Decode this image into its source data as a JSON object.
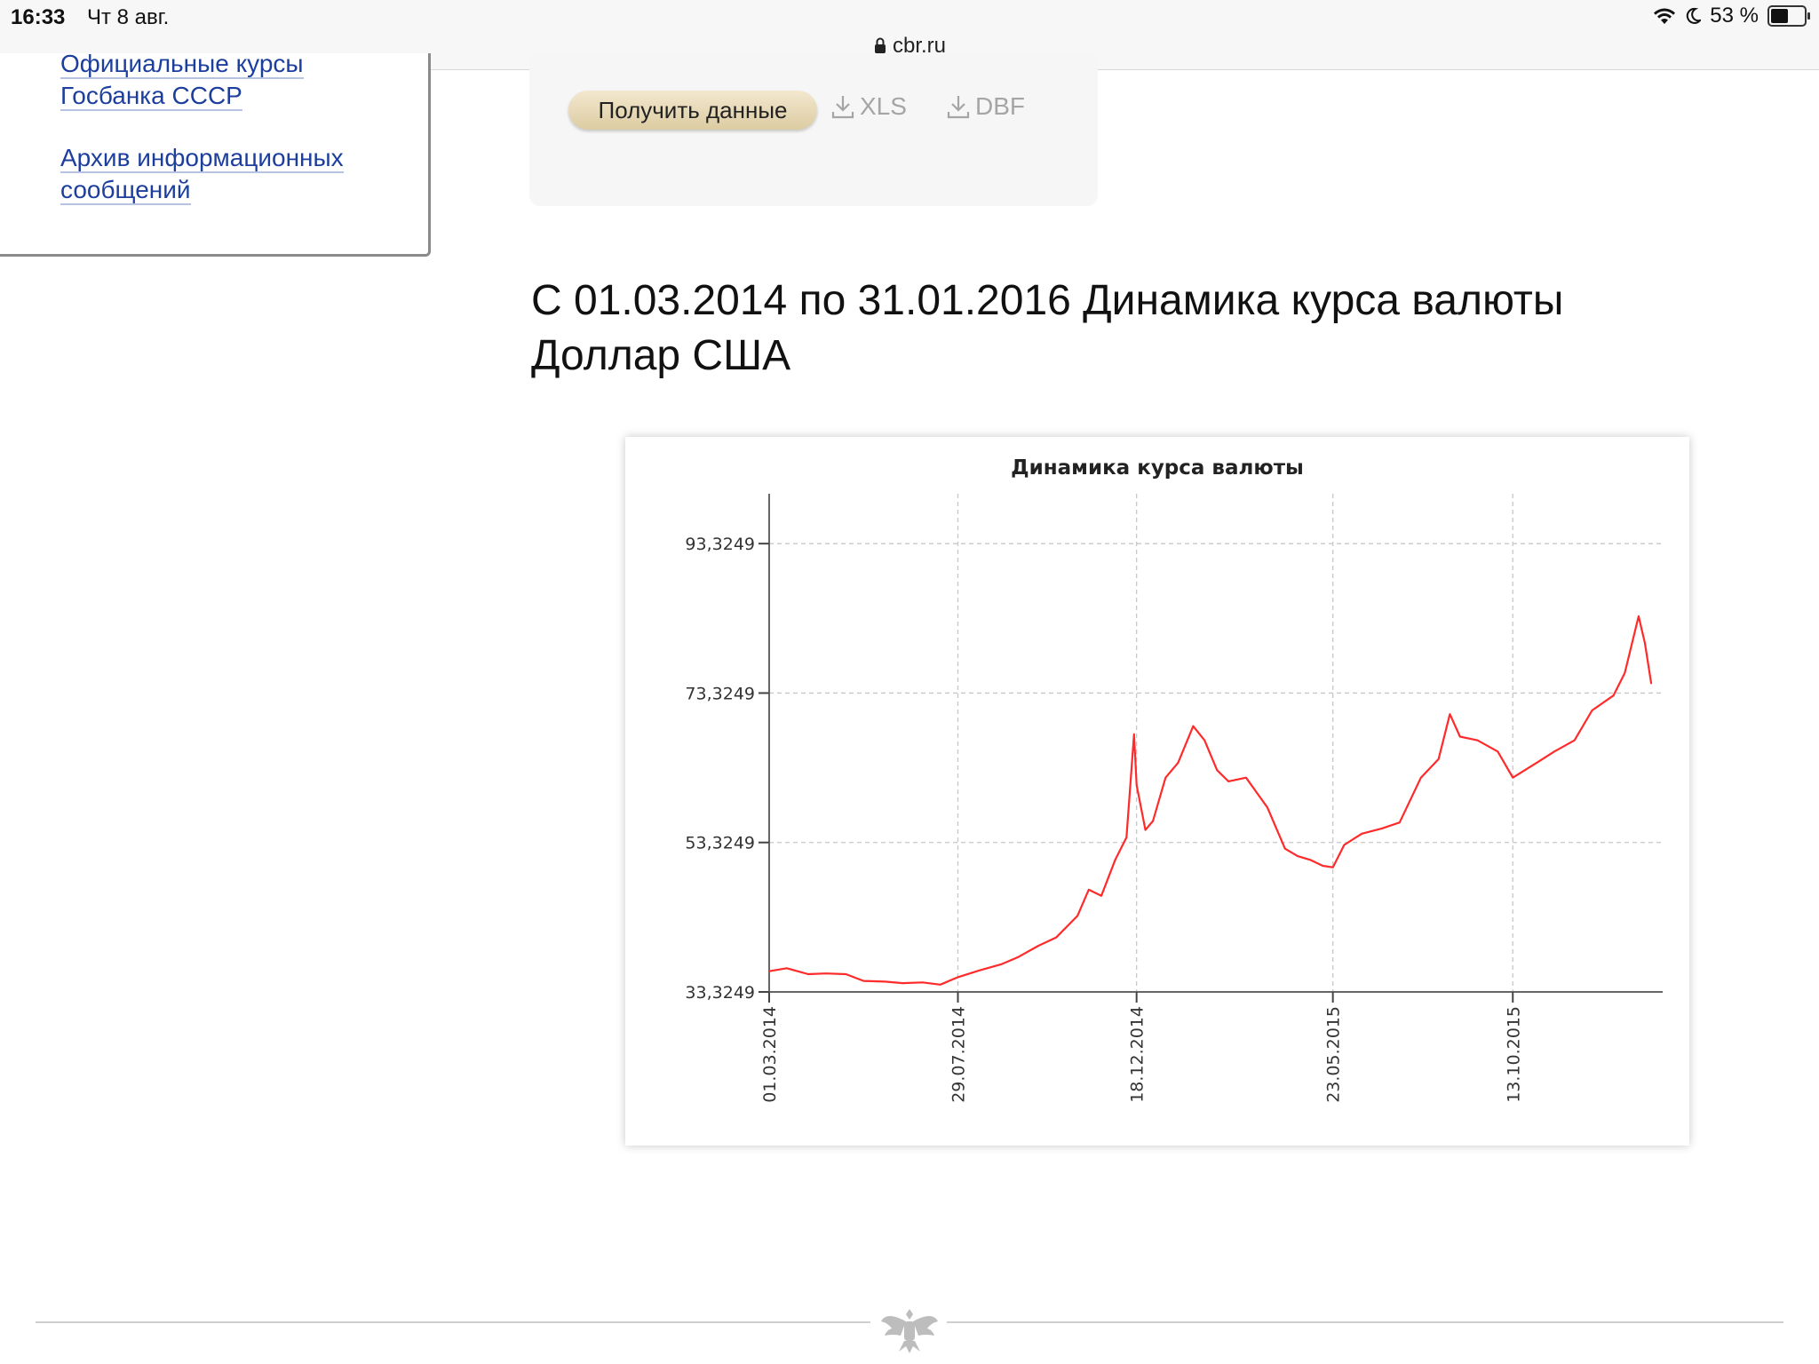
{
  "status_bar": {
    "time": "16:33",
    "date": "Чт 8 авг.",
    "battery": "53 %",
    "battery_level_percent": 53,
    "url": "cbr.ru"
  },
  "sidebar": {
    "links": [
      {
        "lines": [
          "Официальные курсы",
          "Госбанка СССР"
        ]
      },
      {
        "lines": [
          "Архив информационных",
          "сообщений"
        ]
      }
    ]
  },
  "form": {
    "get_data_label": "Получить данные",
    "xls_label": "XLS",
    "dbf_label": "DBF"
  },
  "heading": {
    "line1": "С 01.03.2014 по 31.01.2016 Динамика курса валюты",
    "line2": "Доллар США"
  },
  "colors": {
    "link": "#1c3f9e",
    "line": "#ff2a2a",
    "button": "#e6d8b4"
  },
  "chart_data": {
    "type": "line",
    "title": "Динамика курса валюты",
    "xlabel": "",
    "ylabel": "",
    "grid": true,
    "legend": "none",
    "ylim": [
      33.3249,
      100
    ],
    "y_ticks": [
      "93,3249",
      "73,3249",
      "53,3249",
      "33,3249"
    ],
    "y_tick_values": [
      93.3249,
      73.3249,
      53.3249,
      33.3249
    ],
    "x_ticks": [
      "01.03.2014",
      "29.07.2014",
      "18.12.2014",
      "23.05.2015",
      "13.10.2015"
    ],
    "x_range": [
      "01.03.2014",
      "31.01.2016"
    ],
    "series": [
      {
        "color": "#ff2a2a",
        "points": [
          [
            "01.03.2014",
            36.1
          ],
          [
            "15.03.2014",
            36.5
          ],
          [
            "01.04.2014",
            35.7
          ],
          [
            "15.04.2014",
            35.8
          ],
          [
            "01.05.2014",
            35.7
          ],
          [
            "15.05.2014",
            34.8
          ],
          [
            "01.06.2014",
            34.7
          ],
          [
            "15.06.2014",
            34.5
          ],
          [
            "01.07.2014",
            34.6
          ],
          [
            "15.07.2014",
            34.3
          ],
          [
            "29.07.2014",
            35.3
          ],
          [
            "15.08.2014",
            36.2
          ],
          [
            "01.09.2014",
            37.0
          ],
          [
            "15.09.2014",
            38.0
          ],
          [
            "01.10.2014",
            39.5
          ],
          [
            "15.10.2014",
            40.6
          ],
          [
            "01.11.2014",
            43.5
          ],
          [
            "10.11.2014",
            47.0
          ],
          [
            "20.11.2014",
            46.2
          ],
          [
            "01.12.2014",
            51.0
          ],
          [
            "10.12.2014",
            54.0
          ],
          [
            "16.12.2014",
            67.8
          ],
          [
            "18.12.2014",
            61.0
          ],
          [
            "25.12.2014",
            55.0
          ],
          [
            "31.12.2014",
            56.2
          ],
          [
            "10.01.2015",
            62.0
          ],
          [
            "20.01.2015",
            64.0
          ],
          [
            "01.02.2015",
            68.9
          ],
          [
            "10.02.2015",
            67.0
          ],
          [
            "20.02.2015",
            63.0
          ],
          [
            "01.03.2015",
            61.5
          ],
          [
            "15.03.2015",
            62.0
          ],
          [
            "01.04.2015",
            58.0
          ],
          [
            "15.04.2015",
            52.5
          ],
          [
            "25.04.2015",
            51.5
          ],
          [
            "05.05.2015",
            51.0
          ],
          [
            "15.05.2015",
            50.2
          ],
          [
            "23.05.2015",
            50.0
          ],
          [
            "01.06.2015",
            53.0
          ],
          [
            "15.06.2015",
            54.5
          ],
          [
            "01.07.2015",
            55.2
          ],
          [
            "15.07.2015",
            56.0
          ],
          [
            "01.08.2015",
            62.0
          ],
          [
            "15.08.2015",
            64.5
          ],
          [
            "24.08.2015",
            70.5
          ],
          [
            "01.09.2015",
            67.5
          ],
          [
            "15.09.2015",
            67.0
          ],
          [
            "01.10.2015",
            65.5
          ],
          [
            "13.10.2015",
            62.0
          ],
          [
            "01.11.2015",
            64.0
          ],
          [
            "15.11.2015",
            65.5
          ],
          [
            "01.12.2015",
            67.0
          ],
          [
            "15.12.2015",
            71.0
          ],
          [
            "01.01.2016",
            73.0
          ],
          [
            "10.01.2016",
            76.0
          ],
          [
            "21.01.2016",
            83.6
          ],
          [
            "26.01.2016",
            80.0
          ],
          [
            "31.01.2016",
            74.6
          ]
        ]
      }
    ]
  }
}
